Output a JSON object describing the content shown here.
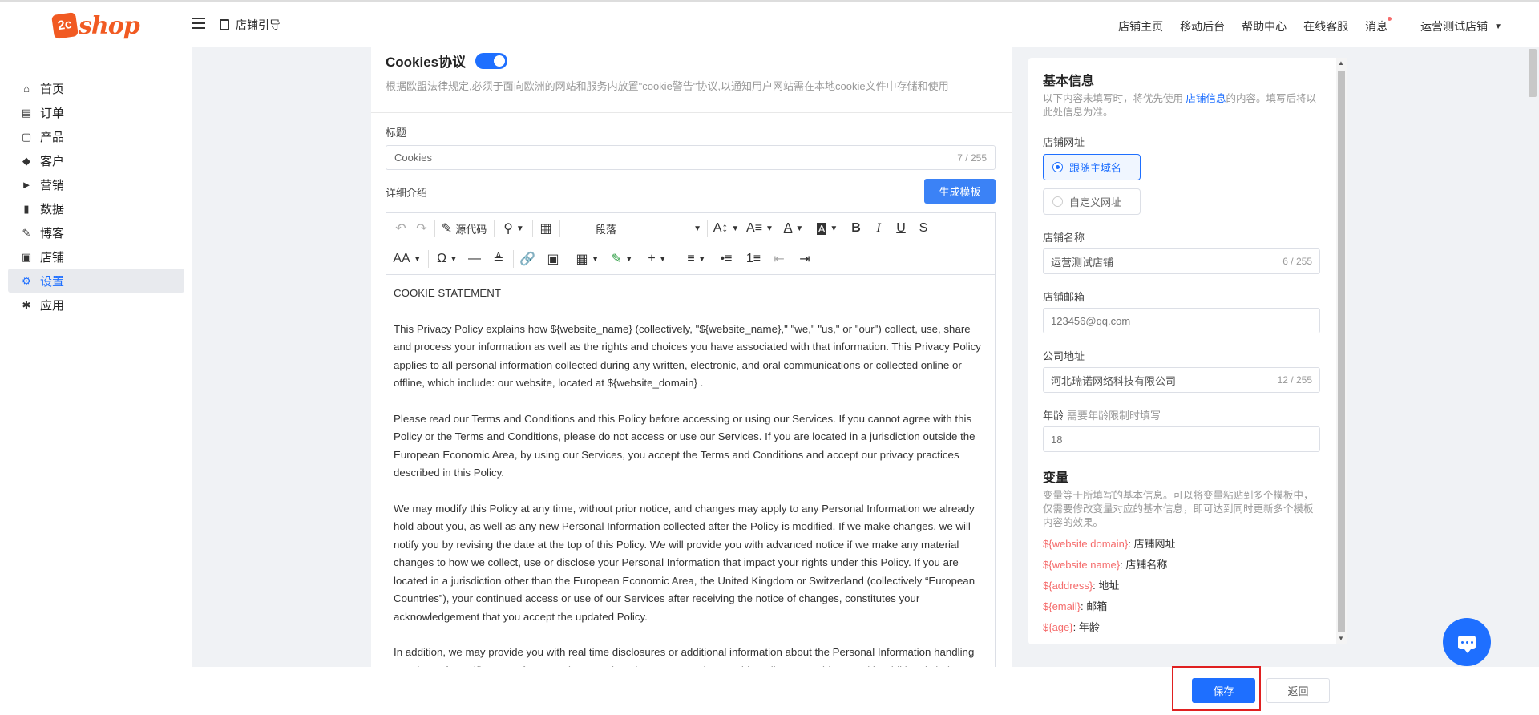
{
  "header": {
    "logo_mark": "2c",
    "logo_text": "shop",
    "guide_label": "店铺引导",
    "links": [
      "店铺主页",
      "移动后台",
      "帮助中心",
      "在线客服",
      "消息"
    ],
    "store_name": "运营测试店铺"
  },
  "sidebar": {
    "items": [
      {
        "label": "首页",
        "icon": "home-icon"
      },
      {
        "label": "订单",
        "icon": "order-icon"
      },
      {
        "label": "产品",
        "icon": "bag-icon"
      },
      {
        "label": "客户",
        "icon": "diamond-icon"
      },
      {
        "label": "营销",
        "icon": "tag-icon"
      },
      {
        "label": "数据",
        "icon": "chart-icon"
      },
      {
        "label": "博客",
        "icon": "edit-icon"
      },
      {
        "label": "店铺",
        "icon": "store-icon"
      },
      {
        "label": "设置",
        "icon": "gear-icon",
        "active": true
      },
      {
        "label": "应用",
        "icon": "puzzle-icon"
      }
    ]
  },
  "cookie": {
    "title": "Cookies协议",
    "enabled": true,
    "description": "根据欧盟法律规定,必须于面向欧洲的网站和服务内放置\"cookie警告\"协议,以通知用户网站需在本地cookie文件中存储和使用",
    "title_label": "标题",
    "title_value": "Cookies",
    "title_counter": "7 / 255",
    "detail_label": "详细介绍",
    "generate_button": "生成模板"
  },
  "editor": {
    "source_code_label": "源代码",
    "paragraph_select": "段落",
    "paragraphs": [
      "COOKIE STATEMENT",
      "This Privacy Policy explains how ${website_name} (collectively, \"${website_name},\" \"we,\" \"us,\" or \"our\") collect, use, share and process your information as well as the rights and choices you have associated with that information. This Privacy Policy applies to all personal information collected during any written, electronic, and oral communications or collected online or offline, which include: our website, located at ${website_domain} .",
      "Please read our Terms and Conditions and this Policy before accessing or using our Services. If you cannot agree with this Policy or the Terms and Conditions, please do not access or use our Services. If you are located in a jurisdiction outside the European Economic Area, by using our Services, you accept the Terms and Conditions and accept our privacy practices described in this Policy.",
      "We may modify this Policy at any time, without prior notice, and changes may apply to any Personal Information we already hold about you, as well as any new Personal Information collected after the Policy is modified. If we make changes, we will notify you by revising the date at the top of this Policy. We will provide you with advanced notice if we make any material changes to how we collect, use or disclose your Personal Information that impact your rights under this Policy. If you are located in a jurisdiction other than the European Economic Area, the United Kingdom or Switzerland (collectively “European Countries”), your continued access or use of our Services after receiving the notice of changes, constitutes your acknowledgement that you accept the updated Policy.",
      "In addition, we may provide you with real time disclosures or additional information about the Personal Information handling practices of specific parts of our Services. Such notices may supplement this Policy or provide you with additional choices about how we process your Personal Information."
    ]
  },
  "basic_info": {
    "title": "基本信息",
    "desc_prefix": "以下内容未填写时，将优先使用",
    "desc_link": "店铺信息",
    "desc_suffix": "的内容。填写后将以此处信息为准。",
    "url_label": "店铺网址",
    "url_options": [
      "跟随主域名",
      "自定义网址"
    ],
    "url_selected": "跟随主域名",
    "name_label": "店铺名称",
    "name_value": "运营测试店铺",
    "name_counter": "6 / 255",
    "email_label": "店铺邮箱",
    "email_placeholder": "123456@qq.com",
    "address_label": "公司地址",
    "address_value": "河北瑞诺网络科技有限公司",
    "address_counter": "12 / 255",
    "age_label": "年龄",
    "age_hint": "需要年龄限制时填写",
    "age_placeholder": "18"
  },
  "variables": {
    "title": "变量",
    "description": "变量等于所填写的基本信息。可以将变量粘贴到多个模板中，仅需要修改变量对应的基本信息，即可达到同时更新多个模板内容的效果。",
    "items": [
      {
        "key": "${website domain}",
        "value": ": 店铺网址"
      },
      {
        "key": "${website name}",
        "value": ": 店铺名称"
      },
      {
        "key": "${address}",
        "value": ": 地址"
      },
      {
        "key": "${email}",
        "value": ": 邮箱"
      },
      {
        "key": "${age}",
        "value": ": 年龄"
      }
    ]
  },
  "footer": {
    "save_label": "保存",
    "back_label": "返回"
  },
  "colors": {
    "primary": "#1e6fff",
    "brand": "#f15a22",
    "variable": "#f56c6c",
    "highlight": "#e02020"
  }
}
